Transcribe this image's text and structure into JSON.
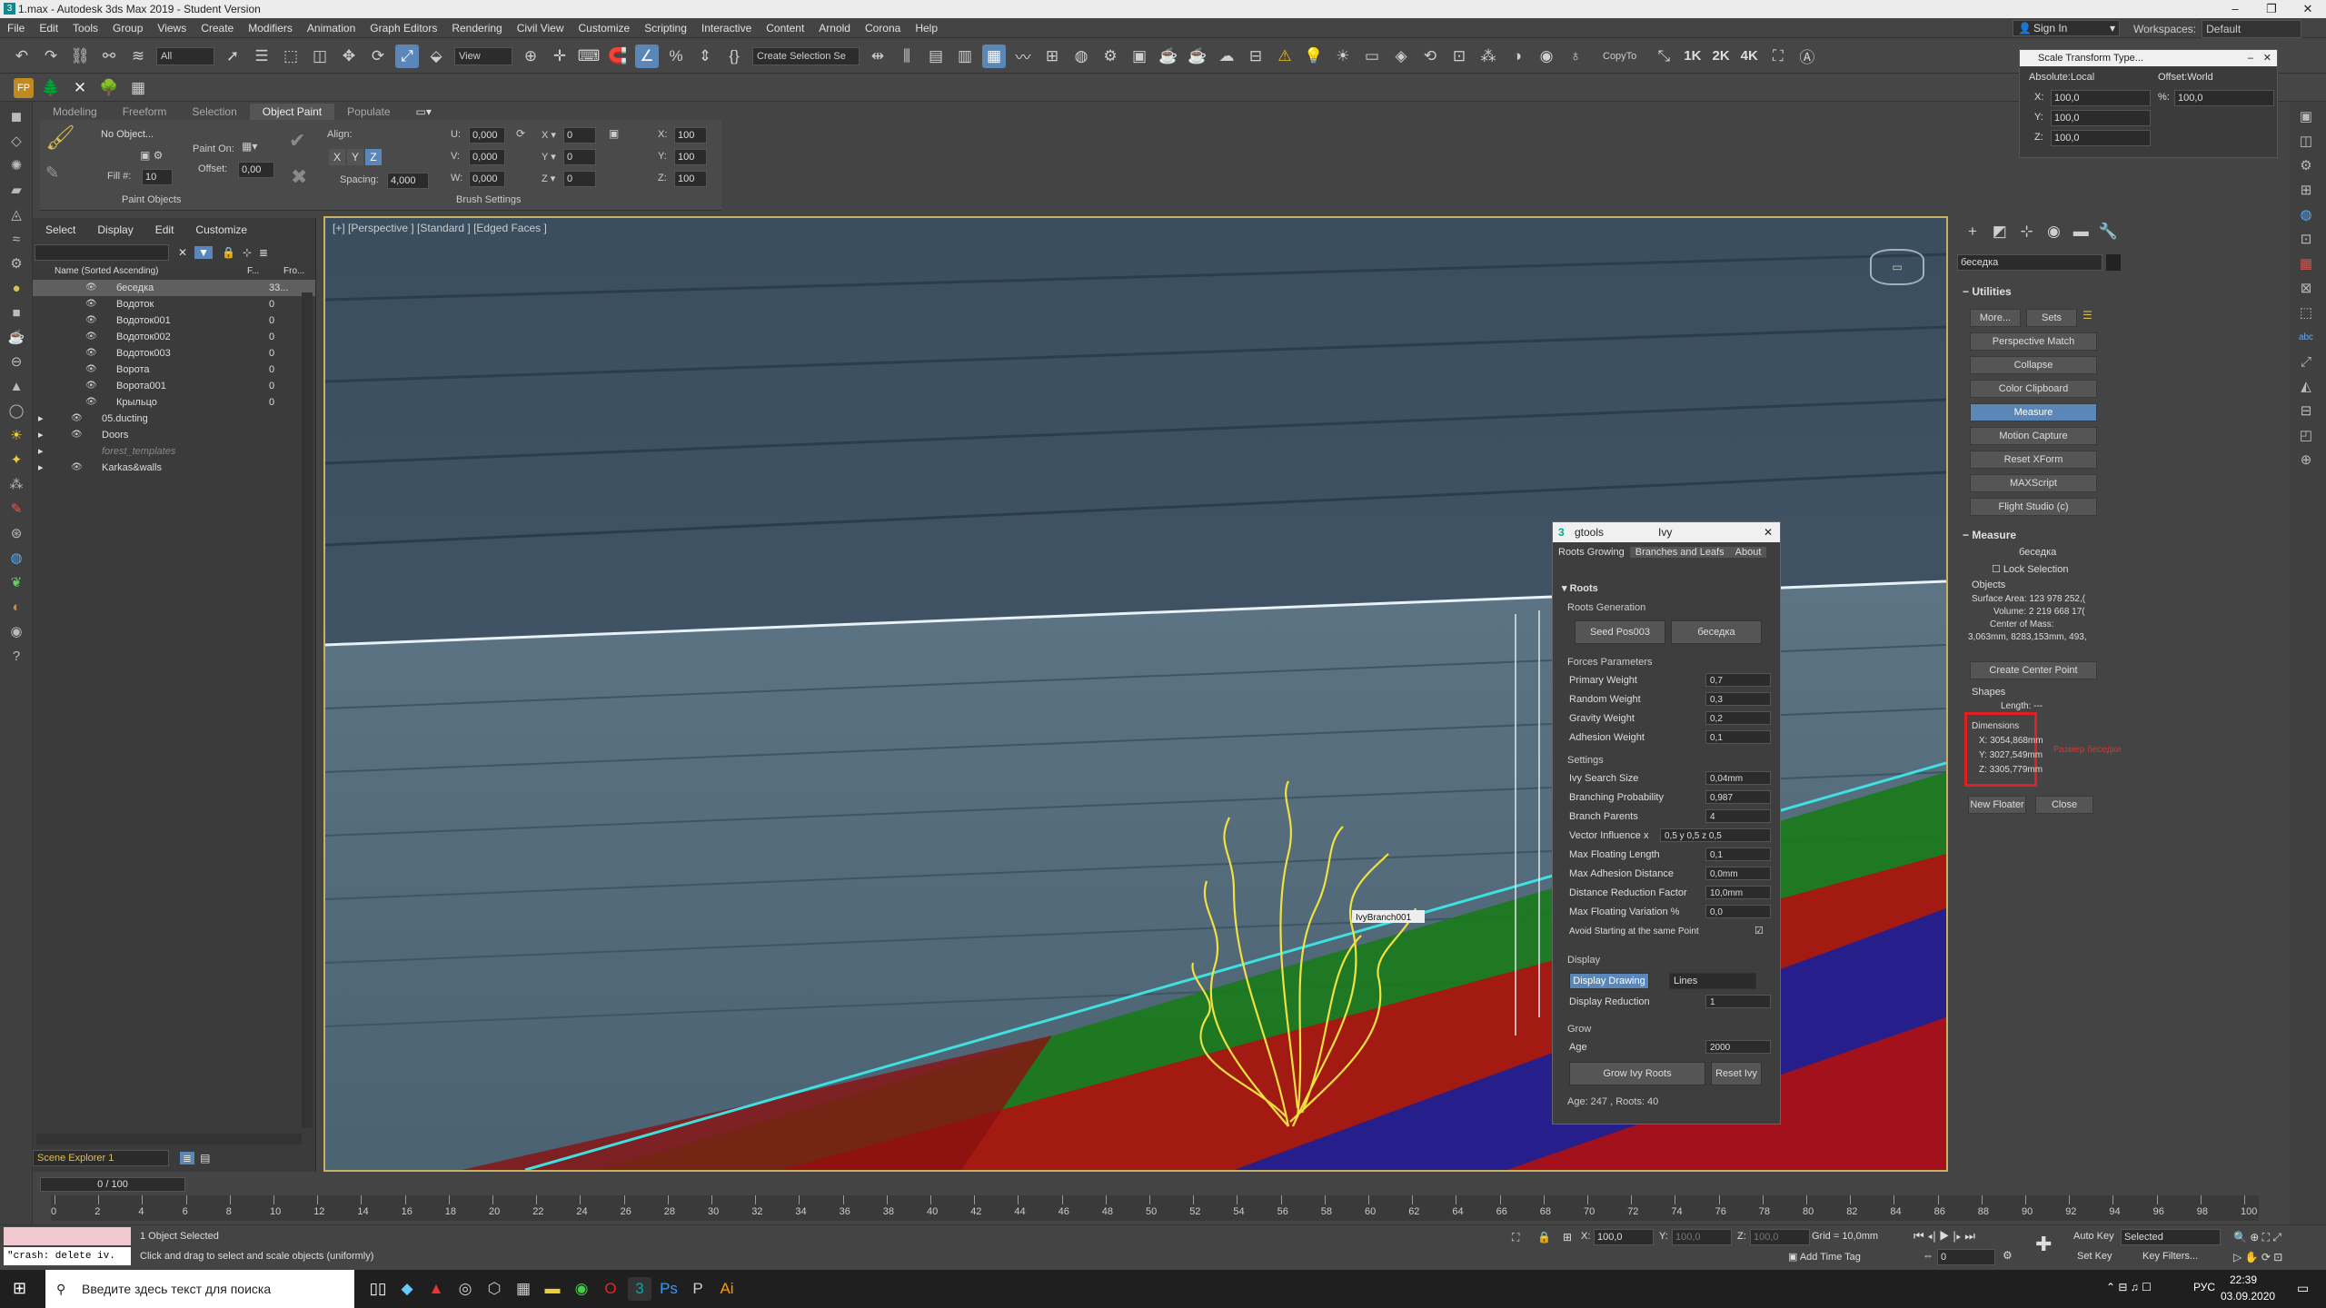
{
  "window": {
    "title": "1.max - Autodesk 3ds Max 2019 - Student Version"
  },
  "menu": [
    "File",
    "Edit",
    "Tools",
    "Group",
    "Views",
    "Create",
    "Modifiers",
    "Animation",
    "Graph Editors",
    "Rendering",
    "Civil View",
    "Customize",
    "Scripting",
    "Interactive",
    "Content",
    "Arnold",
    "Corona",
    "Help"
  ],
  "account": {
    "sign_in": "Sign In",
    "workspaces_label": "Workspaces:",
    "workspace": "Default"
  },
  "toolbar": {
    "selection_filter": "All",
    "ref_coord": "View",
    "selection_set": "Create Selection Se",
    "copyto": "CopyTo",
    "res": [
      "1K",
      "2K",
      "4K"
    ]
  },
  "ribbon": {
    "tabs": [
      "Modeling",
      "Freeform",
      "Selection",
      "Object Paint",
      "Populate"
    ],
    "active_tab": "Object Paint",
    "no_object": "No Object...",
    "paint_on": "Paint On:",
    "offset_label": "Offset:",
    "offset": "0,00",
    "fill_label": "Fill #:",
    "fill": "10",
    "align_label": "Align:",
    "spacing_label": "Spacing:",
    "spacing": "4,000",
    "u": "0,000",
    "v": "0,000",
    "w": "0,000",
    "rx": "0",
    "ry": "0",
    "rz": "0",
    "sx": "100",
    "sy": "100",
    "sz": "100",
    "axis": [
      "X",
      "Y",
      "Z"
    ],
    "paint_objects": "Paint Objects",
    "brush_settings": "Brush Settings"
  },
  "scene": {
    "menu": [
      "Select",
      "Display",
      "Edit",
      "Customize"
    ],
    "col_name": "Name (Sorted Ascending)",
    "col_frozen": "F...",
    "col_flt": "Fro...",
    "rows": [
      {
        "name": "беседка",
        "v": "33...",
        "sel": true
      },
      {
        "name": "Водоток",
        "v": "0"
      },
      {
        "name": "Водоток001",
        "v": "0"
      },
      {
        "name": "Водоток002",
        "v": "0"
      },
      {
        "name": "Водоток003",
        "v": "0"
      },
      {
        "name": "Ворота",
        "v": "0"
      },
      {
        "name": "Ворота001",
        "v": "0"
      },
      {
        "name": "Крыльцо",
        "v": "0"
      }
    ],
    "layers": [
      "05.ducting",
      "Doors",
      "forest_templates",
      "Karkas&walls"
    ],
    "explorer": "Scene Explorer 1"
  },
  "viewport": {
    "label": "[+] [Perspective ] [Standard ] [Edged Faces ]",
    "tag": "IvyBranch001"
  },
  "scale_tx": {
    "title": "Scale Transform Type...",
    "abs": "Absolute:Local",
    "off": "Offset:World",
    "x": "100,0",
    "y": "100,0",
    "z": "100,0",
    "pct": "100,0",
    "xl": "X:",
    "yl": "Y:",
    "zl": "Z:",
    "pl": "%:"
  },
  "cmd": {
    "object_name": "беседка",
    "utilities": "Utilities",
    "more": "More...",
    "sets": "Sets",
    "buttons": [
      "Perspective Match",
      "Collapse",
      "Color Clipboard",
      "Measure",
      "Motion Capture",
      "Reset XForm",
      "MAXScript",
      "Flight Studio (c)"
    ],
    "measure_title": "Measure",
    "measure_name": "беседка",
    "lock_selection": "Lock Selection",
    "objects": "Objects",
    "surface_area": "Surface Area:  123 978 252,(",
    "volume": "Volume:  2 219 668 17(",
    "com": "Center of Mass:",
    "com_val": "3,063mm, 8283,153mm, 493,",
    "create_center": "Create Center Point",
    "shapes": "Shapes",
    "length": "Length:  ---",
    "dimensions": "Dimensions",
    "dx": "X:  3054,868mm",
    "dy": "Y:  3027,549mm",
    "dz": "Z:  3305,779mm",
    "annotation": "Размер беседки",
    "new_floater": "New Floater",
    "close": "Close"
  },
  "ivy": {
    "title": "gtools",
    "subtitle": "Ivy",
    "tabs": [
      "Roots Growing",
      "Branches and Leafs",
      "About"
    ],
    "roots": "Roots",
    "roots_gen": "Roots Generation",
    "seed": "Seed Pos003",
    "target": "беседка",
    "forces": "Forces Parameters",
    "force_rows": [
      [
        "Primary Weight",
        "0,7"
      ],
      [
        "Random Weight",
        "0,3"
      ],
      [
        "Gravity Weight",
        "0,2"
      ],
      [
        "Adhesion Weight",
        "0,1"
      ]
    ],
    "settings": "Settings",
    "setting_rows": [
      [
        "Ivy Search Size",
        "0,04mm"
      ],
      [
        "Branching Probability",
        "0,987"
      ],
      [
        "Branch Parents",
        "4"
      ],
      [
        "Vector Influence  x",
        "0,5  y 0,5  z 0,5"
      ],
      [
        "Max Floating Length",
        "0,1"
      ],
      [
        "Max Adhesion Distance",
        "0,0mm"
      ],
      [
        "Distance Reduction Factor",
        "10,0mm"
      ],
      [
        "Max Floating Variation  %",
        "0,0"
      ]
    ],
    "avoid": "Avoid Starting at the same Point",
    "display": "Display",
    "display_drawing": "Display Drawing",
    "lines": "Lines",
    "display_reduction": "Display Reduction",
    "display_reduction_val": "1",
    "grow": "Grow",
    "age": "Age",
    "age_val": "2000",
    "grow_btn": "Grow Ivy Roots",
    "reset_btn": "Reset Ivy",
    "status": "Age: 247 , Roots: 40"
  },
  "timeline": {
    "frame": "0 / 100",
    "ticks": [
      "0",
      "2",
      "4",
      "6",
      "8",
      "10",
      "12",
      "14",
      "16",
      "18",
      "20",
      "22",
      "24",
      "26",
      "28",
      "30",
      "32",
      "34",
      "36",
      "38",
      "40",
      "42",
      "44",
      "46",
      "48",
      "50",
      "52",
      "54",
      "56",
      "58",
      "60",
      "62",
      "64",
      "66",
      "68",
      "70",
      "72",
      "74",
      "76",
      "78",
      "80",
      "82",
      "84",
      "86",
      "88",
      "90",
      "92",
      "94",
      "96",
      "98",
      "100"
    ]
  },
  "status": {
    "maxscript": "\"crash: delete iv.",
    "selected": "1 Object Selected",
    "prompt": "Click and drag to select and scale objects (uniformly)",
    "x": "100,0",
    "y": "100,0",
    "z": "100,0",
    "grid": "Grid = 10,0mm",
    "add_time_tag": "Add Time Tag",
    "auto_key": "Auto Key",
    "set_key": "Set Key",
    "selected_dd": "Selected",
    "key_filters": "Key Filters...",
    "frame_field": "0"
  },
  "taskbar": {
    "search": "Введите здесь текст для поиска",
    "lang": "РУС",
    "time": "22:39",
    "date": "03.09.2020"
  }
}
